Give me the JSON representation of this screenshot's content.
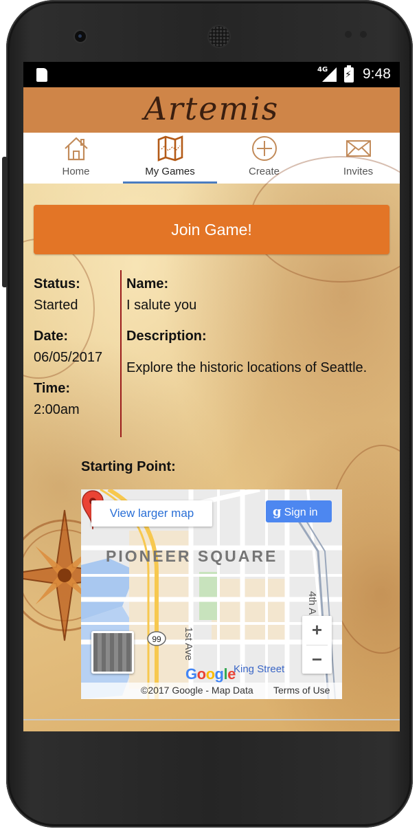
{
  "status_bar": {
    "network": "4G",
    "time": "9:48"
  },
  "app": {
    "title": "Artemis"
  },
  "tabs": [
    {
      "label": "Home",
      "icon": "home-icon"
    },
    {
      "label": "My Games",
      "icon": "map-icon",
      "active": true
    },
    {
      "label": "Create",
      "icon": "plus-circle-icon"
    },
    {
      "label": "Invites",
      "icon": "envelope-icon"
    }
  ],
  "join_button": {
    "label": "Join Game!"
  },
  "game": {
    "status_label": "Status:",
    "status": "Started",
    "date_label": "Date:",
    "date": "06/05/2017",
    "time_label": "Time:",
    "time": "2:00am",
    "name_label": "Name:",
    "name": "I salute you",
    "description_label": "Description:",
    "description": "Explore the historic locations of Seattle."
  },
  "starting_point": {
    "label": "Starting Point:",
    "map": {
      "view_larger": "View larger map",
      "sign_in": "Sign in",
      "neighborhood": "PIONEER SQUARE",
      "street_1": "1st Ave",
      "street_2": "4th A",
      "street_3": "King Street",
      "highway": "99",
      "zoom_in": "+",
      "zoom_out": "−",
      "logo": "Google",
      "copyright": "©2017 Google - Map Data",
      "terms": "Terms of Use"
    }
  },
  "colors": {
    "header": "#cf8548",
    "accent_orange": "#e37526",
    "tab_underline": "#4a7cc0",
    "divider": "#9b1c1c",
    "map_link": "#2a6fd6"
  }
}
